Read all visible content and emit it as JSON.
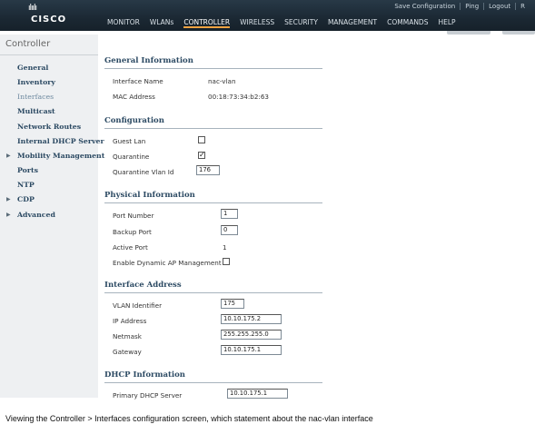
{
  "header": {
    "brand": "CISCO",
    "logo_marks": "ılıılı",
    "top_links": [
      "Save Configuration",
      "Ping",
      "Logout",
      "R"
    ],
    "nav": [
      {
        "label": "MONITOR",
        "active": false
      },
      {
        "label": "WLANs",
        "active": false
      },
      {
        "label": "CONTROLLER",
        "active": true
      },
      {
        "label": "WIRELESS",
        "active": false
      },
      {
        "label": "SECURITY",
        "active": false
      },
      {
        "label": "MANAGEMENT",
        "active": false
      },
      {
        "label": "COMMANDS",
        "active": false
      },
      {
        "label": "HELP",
        "active": false
      }
    ]
  },
  "sidebar": {
    "title": "Controller",
    "items": [
      {
        "label": "General",
        "expandable": false,
        "current": false
      },
      {
        "label": "Inventory",
        "expandable": false,
        "current": false
      },
      {
        "label": "Interfaces",
        "expandable": false,
        "current": true
      },
      {
        "label": "Multicast",
        "expandable": false,
        "current": false
      },
      {
        "label": "Network Routes",
        "expandable": false,
        "current": false
      },
      {
        "label": "Internal DHCP Server",
        "expandable": false,
        "current": false
      },
      {
        "label": "Mobility Management",
        "expandable": true,
        "current": false
      },
      {
        "label": "Ports",
        "expandable": false,
        "current": false
      },
      {
        "label": "NTP",
        "expandable": false,
        "current": false
      },
      {
        "label": "CDP",
        "expandable": true,
        "current": false
      },
      {
        "label": "Advanced",
        "expandable": true,
        "current": false
      }
    ]
  },
  "general": {
    "title": "General Information",
    "interface_name_label": "Interface Name",
    "interface_name": "nac-vlan",
    "mac_label": "MAC Address",
    "mac": "00:18:73:34:b2:63"
  },
  "configuration": {
    "title": "Configuration",
    "guest_lan_label": "Guest Lan",
    "guest_lan_checked": false,
    "quarantine_label": "Quarantine",
    "quarantine_checked": true,
    "quarantine_vlan_label": "Quarantine Vlan Id",
    "quarantine_vlan_id": "176"
  },
  "physical": {
    "title": "Physical Information",
    "port_number_label": "Port Number",
    "port_number": "1",
    "backup_port_label": "Backup Port",
    "backup_port": "0",
    "active_port_label": "Active Port",
    "active_port": "1",
    "dynamic_ap_label": "Enable Dynamic AP Management",
    "dynamic_ap_checked": false
  },
  "interface_address": {
    "title": "Interface Address",
    "vlan_label": "VLAN Identifier",
    "vlan": "175",
    "ip_label": "IP Address",
    "ip": "10.10.175.2",
    "netmask_label": "Netmask",
    "netmask": "255.255.255.0",
    "gateway_label": "Gateway",
    "gateway": "10.10.175.1"
  },
  "dhcp": {
    "title": "DHCP Information",
    "primary_label": "Primary DHCP Server",
    "primary": "10.10.175.1"
  },
  "question": "Viewing the Controller > Interfaces configuration screen, which statement about the nac-vlan interface",
  "colors": {
    "header_bg": "#1b2833",
    "active_tab_underline": "#f1a341",
    "sidebar_bg": "#eef0f2",
    "section_title": "#2c4a63"
  }
}
